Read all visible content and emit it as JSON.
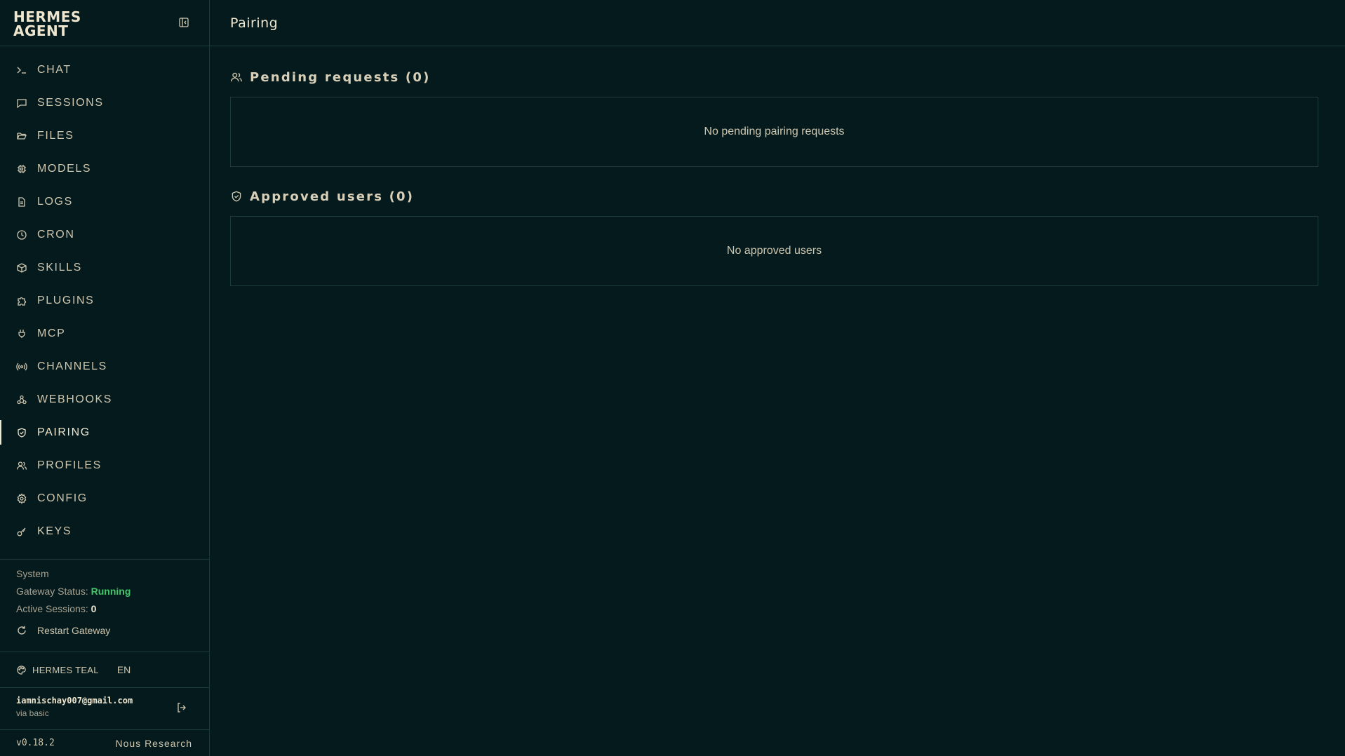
{
  "brand": {
    "line1": "HERMES",
    "line2": "AGENT"
  },
  "nav": {
    "items": [
      {
        "label": "CHAT",
        "icon": "terminal-icon"
      },
      {
        "label": "SESSIONS",
        "icon": "message-square-icon"
      },
      {
        "label": "FILES",
        "icon": "folder-open-icon"
      },
      {
        "label": "MODELS",
        "icon": "cpu-icon"
      },
      {
        "label": "LOGS",
        "icon": "file-text-icon"
      },
      {
        "label": "CRON",
        "icon": "clock-icon"
      },
      {
        "label": "SKILLS",
        "icon": "package-icon"
      },
      {
        "label": "PLUGINS",
        "icon": "puzzle-icon"
      },
      {
        "label": "MCP",
        "icon": "plug-icon"
      },
      {
        "label": "CHANNELS",
        "icon": "radio-icon"
      },
      {
        "label": "WEBHOOKS",
        "icon": "webhook-icon"
      },
      {
        "label": "PAIRING",
        "icon": "shield-check-icon",
        "active": true
      },
      {
        "label": "PROFILES",
        "icon": "users-icon"
      },
      {
        "label": "CONFIG",
        "icon": "settings-icon"
      },
      {
        "label": "KEYS",
        "icon": "key-icon"
      }
    ]
  },
  "system": {
    "heading": "System",
    "gateway_label": "Gateway Status:",
    "gateway_value": "Running",
    "sessions_label": "Active Sessions:",
    "sessions_value": "0",
    "restart_label": "Restart Gateway"
  },
  "theme": {
    "label": "HERMES TEAL",
    "lang": "EN"
  },
  "user": {
    "email": "iamnischay007@gmail.com",
    "via": "via basic"
  },
  "footer": {
    "version": "v0.18.2",
    "vendor": "Nous Research"
  },
  "page": {
    "title": "Pairing"
  },
  "pending": {
    "title": "Pending requests (0)",
    "empty": "No pending pairing requests"
  },
  "approved": {
    "title": "Approved users (0)",
    "empty": "No approved users"
  },
  "colors": {
    "background": "#041a1d",
    "border": "#1d3a3d",
    "text": "#d8cfb8",
    "status_ok": "#44c76a"
  }
}
